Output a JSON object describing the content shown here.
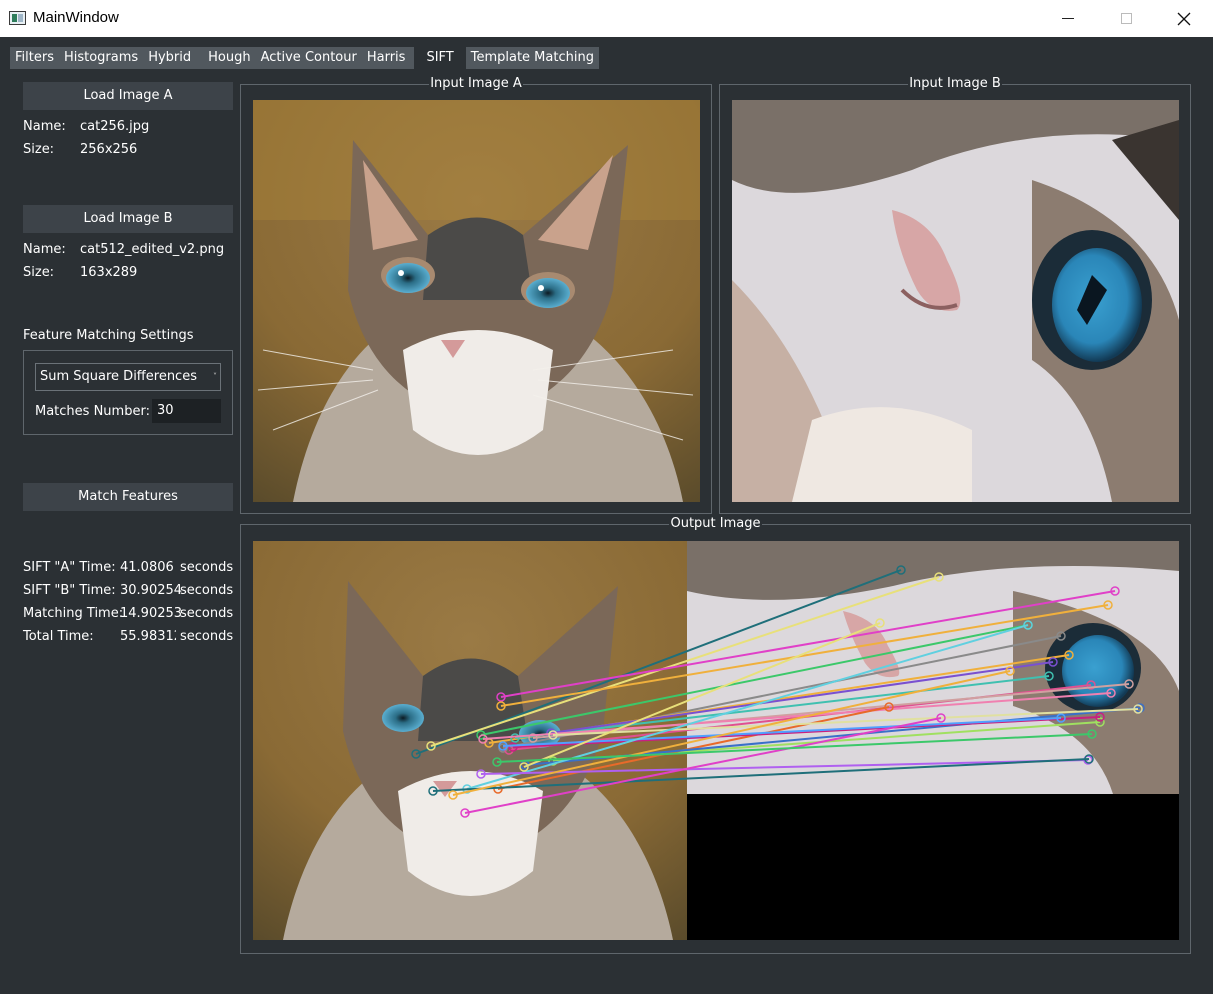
{
  "window": {
    "title": "MainWindow"
  },
  "tabs": [
    {
      "label": "Filters"
    },
    {
      "label": "Histograms"
    },
    {
      "label": "Hybrid"
    },
    {
      "label": "Hough"
    },
    {
      "label": "Active Contour"
    },
    {
      "label": "Harris"
    },
    {
      "label": "SIFT"
    },
    {
      "label": "Template Matching"
    }
  ],
  "active_tab": "SIFT",
  "image_a": {
    "button": "Load Image A",
    "name_label": "Name:",
    "name": "cat256.jpg",
    "size_label": "Size:",
    "size": "256x256"
  },
  "image_b": {
    "button": "Load Image B",
    "name_label": "Name:",
    "name": "cat512_edited_v2.png",
    "size_label": "Size:",
    "size": "163x289"
  },
  "settings": {
    "title": "Feature Matching Settings",
    "method": "Sum Square Differences",
    "matches_label": "Matches Number:",
    "matches_value": "30"
  },
  "match_button": "Match Features",
  "timings": [
    {
      "label": "SIFT \"A\" Time:",
      "value": "41.0806",
      "unit": "seconds"
    },
    {
      "label": "SIFT \"B\" Time:",
      "value": "30.90254",
      "unit": "seconds"
    },
    {
      "label": "Matching Time:",
      "value": "14.90253",
      "unit": "seconds"
    },
    {
      "label": "Total Time:",
      "value": "55.98312",
      "unit": "seconds"
    }
  ],
  "groups": {
    "input_a": "Input Image A",
    "input_b": "Input Image B",
    "output": "Output Image"
  },
  "match_colors": [
    "#1f6f7a",
    "#e8e07a",
    "#e040c8",
    "#f0b03c",
    "#3cc86a",
    "#8a8a8a",
    "#f0b03c",
    "#40c0b0",
    "#e05090",
    "#7a50d0",
    "#d0a0a0",
    "#f080b0",
    "#a0e060",
    "#e86a2a",
    "#3a70c8",
    "#c82080",
    "#50a0ff",
    "#e0e0a0",
    "#60d0e0",
    "#b060f0"
  ]
}
